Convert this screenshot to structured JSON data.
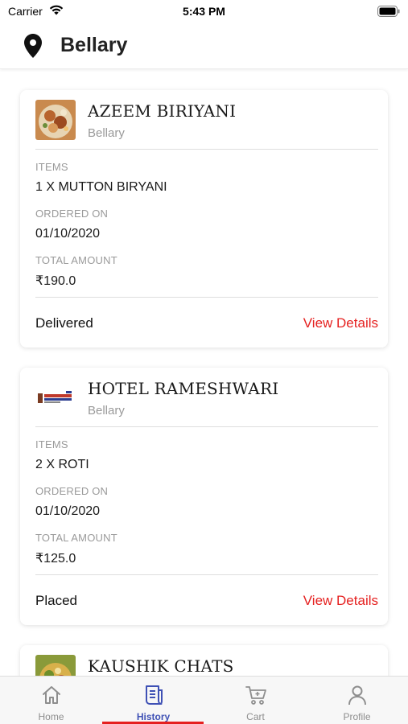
{
  "status_bar": {
    "carrier": "Carrier",
    "time": "5:43 PM"
  },
  "header": {
    "icon": "location-pin-icon",
    "city": "Bellary"
  },
  "orders": [
    {
      "restaurant": "AZEEM BIRIYANI",
      "location": "Bellary",
      "thumbnail": "biryani-food-image",
      "items_label": "ITEMS",
      "items": "1 X MUTTON BIRYANI",
      "ordered_label": "ORDERED ON",
      "ordered_on": "01/10/2020",
      "total_label": "TOTAL AMOUNT",
      "total": "₹190.0",
      "status": "Delivered",
      "action": "View Details"
    },
    {
      "restaurant": "HOTEL RAMESHWARI",
      "location": "Bellary",
      "thumbnail": "hotel-logo-image",
      "items_label": "ITEMS",
      "items": "2 X ROTI",
      "ordered_label": "ORDERED ON",
      "ordered_on": "01/10/2020",
      "total_label": "TOTAL AMOUNT",
      "total": "₹125.0",
      "status": "Placed",
      "action": "View Details"
    },
    {
      "restaurant": "KAUSHIK CHATS",
      "thumbnail": "chat-food-image"
    }
  ],
  "tabs": [
    {
      "label": "Home",
      "icon": "home-icon",
      "active": false
    },
    {
      "label": "History",
      "icon": "history-icon",
      "active": true
    },
    {
      "label": "Cart",
      "icon": "cart-icon",
      "active": false
    },
    {
      "label": "Profile",
      "icon": "profile-icon",
      "active": false
    }
  ],
  "colors": {
    "accent_red": "#e5201f",
    "active_tab": "#3f51b5",
    "muted_text": "#9a9a9a"
  }
}
